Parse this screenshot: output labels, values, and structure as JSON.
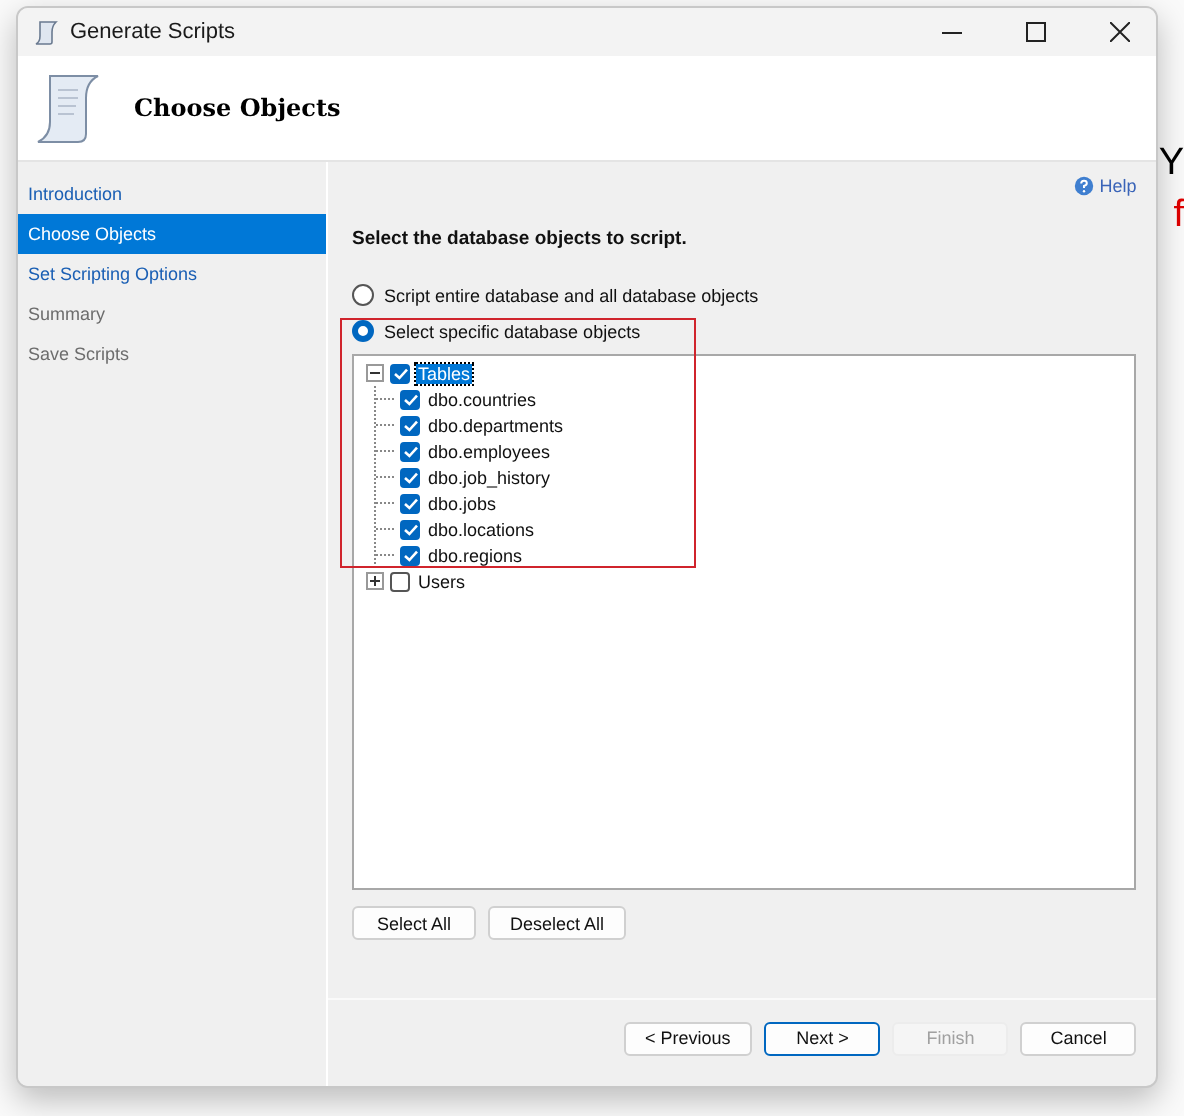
{
  "window": {
    "title": "Generate Scripts"
  },
  "header": {
    "title": "Choose Objects"
  },
  "sidebar": {
    "items": [
      {
        "label": "Introduction",
        "selected": false,
        "disabled": false
      },
      {
        "label": "Choose Objects",
        "selected": true,
        "disabled": false
      },
      {
        "label": "Set Scripting Options",
        "selected": false,
        "disabled": false
      },
      {
        "label": "Summary",
        "selected": false,
        "disabled": true
      },
      {
        "label": "Save Scripts",
        "selected": false,
        "disabled": true
      }
    ]
  },
  "help": "Help",
  "instruction": "Select the database objects to script.",
  "options": [
    {
      "label": "Script entire database and all database objects",
      "selected": false
    },
    {
      "label": "Select specific database objects",
      "selected": true
    }
  ],
  "tree": [
    {
      "label": "Tables",
      "checked": true,
      "expanded": true,
      "selected": true,
      "children": [
        {
          "label": "dbo.countries",
          "checked": true
        },
        {
          "label": "dbo.departments",
          "checked": true
        },
        {
          "label": "dbo.employees",
          "checked": true
        },
        {
          "label": "dbo.job_history",
          "checked": true
        },
        {
          "label": "dbo.jobs",
          "checked": true
        },
        {
          "label": "dbo.locations",
          "checked": true
        },
        {
          "label": "dbo.regions",
          "checked": true
        }
      ]
    },
    {
      "label": "Users",
      "checked": false,
      "expanded": false,
      "selected": false
    }
  ],
  "tree_buttons": [
    "Select All",
    "Deselect All"
  ],
  "nav_buttons": [
    {
      "label": "< Previous",
      "disabled": false,
      "default": false
    },
    {
      "label": "Next >",
      "disabled": false,
      "default": true
    },
    {
      "label": "Finish",
      "disabled": true,
      "default": false
    },
    {
      "label": "Cancel",
      "disabled": false,
      "default": false
    }
  ],
  "background": {
    "texts": [
      {
        "text": "Y",
        "color": "#000000"
      },
      {
        "text": "f",
        "color": "#e00000"
      }
    ]
  }
}
